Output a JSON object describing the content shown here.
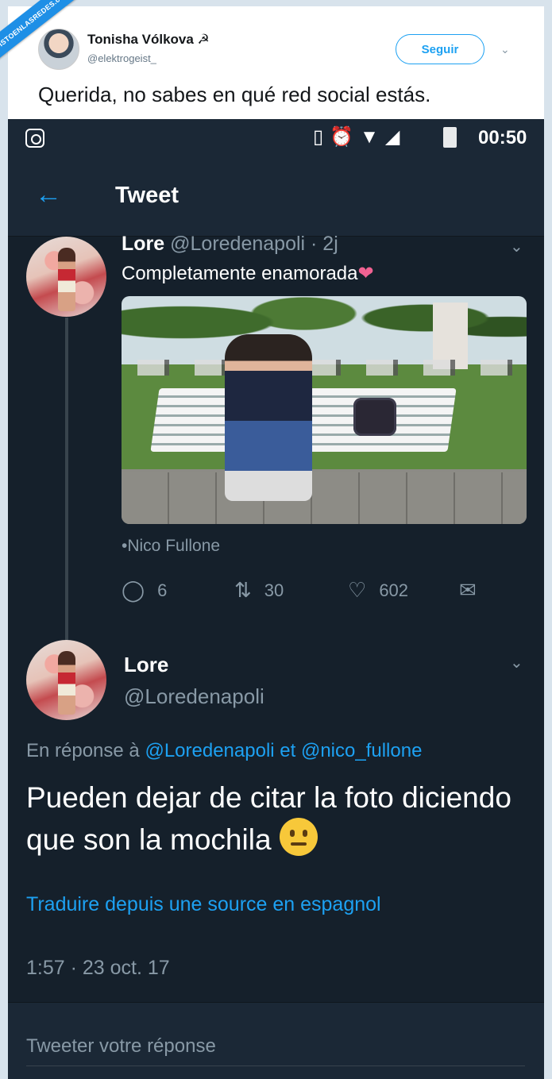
{
  "outer_tweet": {
    "name": "Tonisha Vólkova ☭",
    "handle": "@elektrogeist_",
    "follow_label": "Seguir",
    "text": "Querida, no sabes en qué red social estás."
  },
  "watermark": "VISTOENLASREDES.com",
  "status_bar": {
    "time": "00:50",
    "icons": [
      "instagram-icon",
      "vibrate-icon",
      "alarm-icon",
      "wifi-icon",
      "signal-icon",
      "battery-icon"
    ]
  },
  "app_bar": {
    "title": "Tweet"
  },
  "quoted_tweet": {
    "name": "Lore",
    "handle_time": "@Loredenapoli · 2j",
    "text": "Completamente enamorada",
    "emoji": "❤",
    "credit": "•Nico Fullone",
    "replies": "6",
    "retweets": "30",
    "likes": "602"
  },
  "main_tweet": {
    "name": "Lore",
    "handle": "@Loredenapoli",
    "reply_prefix": "En réponse à",
    "reply_mention_1": "@Loredenapoli",
    "reply_joiner": "et",
    "reply_mention_2": "@nico_fullone",
    "text": "Pueden dejar de citar la foto diciendo que son la mochila",
    "translate_label": "Traduire depuis une source en espagnol",
    "timestamp": "1:57 · 23 oct. 17"
  },
  "reply_box": {
    "placeholder": "Tweeter votre réponse"
  },
  "colors": {
    "accent": "#1da1f2",
    "background": "#15202b",
    "secondary_text": "#8899a6"
  }
}
